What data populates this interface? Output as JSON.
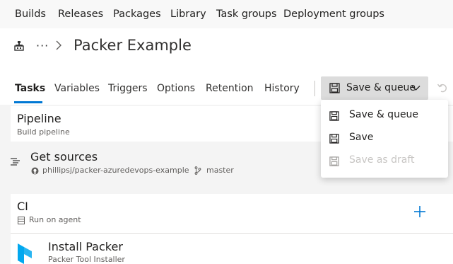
{
  "top_nav": {
    "items": [
      "Builds",
      "Releases",
      "Packages",
      "Library",
      "Task groups",
      "Deployment groups"
    ]
  },
  "header": {
    "more": "···",
    "title": "Packer Example"
  },
  "tabs": {
    "items": [
      "Tasks",
      "Variables",
      "Triggers",
      "Options",
      "Retention",
      "History"
    ],
    "active": "Tasks"
  },
  "toolbar": {
    "save_queue_label": "Save & queue"
  },
  "dropdown_menu": {
    "items": [
      {
        "label": "Save & queue",
        "enabled": true
      },
      {
        "label": "Save",
        "enabled": true
      },
      {
        "label": "Save as draft",
        "enabled": false
      }
    ]
  },
  "pipeline": {
    "title": "Pipeline",
    "subtitle": "Build pipeline"
  },
  "get_sources": {
    "title": "Get sources",
    "repo": "phillipsj/packer-azuredevops-example",
    "branch": "master"
  },
  "ci_job": {
    "title": "CI",
    "subtitle": "Run on agent"
  },
  "task": {
    "title": "Install Packer",
    "subtitle": "Packer Tool Installer"
  },
  "colors": {
    "accent": "#0078d4",
    "packer": "#02a8ef"
  }
}
